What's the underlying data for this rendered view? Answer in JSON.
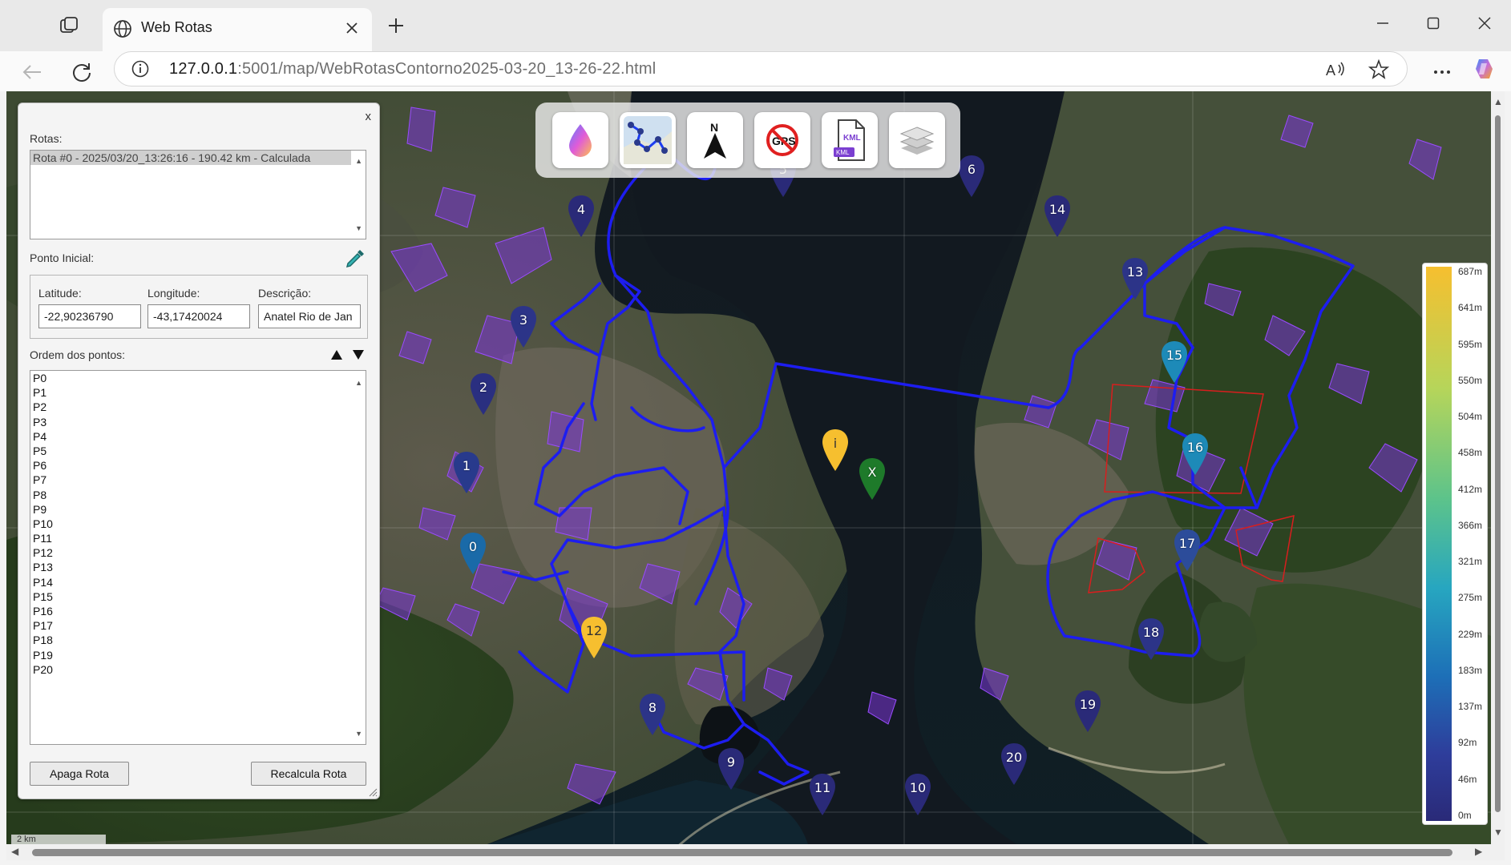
{
  "browser": {
    "tab_title": "Web Rotas",
    "url_host": "127.0.0.1",
    "url_rest": ":5001/map/WebRotasContorno2025-03-20_13-26-22.html"
  },
  "panel": {
    "close_label": "x",
    "routes_label": "Rotas:",
    "routes": [
      "Rota #0 - 2025/03/20_13:26:16 - 190.42 km - Calculada"
    ],
    "start_label": "Ponto Inicial:",
    "lat_label": "Latitude:",
    "lon_label": "Longitude:",
    "desc_label": "Descrição:",
    "lat_value": "-22,90236790",
    "lon_value": "-43,17420024",
    "desc_value": "Anatel Rio de Jan",
    "order_label": "Ordem dos pontos:",
    "points": [
      "P0",
      "P1",
      "P2",
      "P3",
      "P4",
      "P5",
      "P6",
      "P7",
      "P8",
      "P9",
      "P10",
      "P11",
      "P12",
      "P13",
      "P14",
      "P15",
      "P16",
      "P17",
      "P18",
      "P19",
      "P20"
    ],
    "delete_button": "Apaga Rota",
    "recalc_button": "Recalcula Rota"
  },
  "toolbar_icons": [
    "elevation-drop-icon",
    "route-map-icon",
    "north-arrow-icon",
    "no-gps-icon",
    "kml-file-icon",
    "layers-icon"
  ],
  "legend": {
    "labels": [
      "687m",
      "641m",
      "595m",
      "550m",
      "504m",
      "458m",
      "412m",
      "366m",
      "321m",
      "275m",
      "229m",
      "183m",
      "137m",
      "92m",
      "46m",
      "0m"
    ],
    "colors": {
      "top": "#f6bf2f",
      "middle": "#27a6c0",
      "bottom": "#2a2a78"
    }
  },
  "markers": {
    "start": "i",
    "end": "X",
    "points": [
      "0",
      "1",
      "2",
      "3",
      "4",
      "5",
      "6",
      "8",
      "9",
      "10",
      "11",
      "12",
      "13",
      "14",
      "15",
      "16",
      "17",
      "18",
      "19",
      "20"
    ]
  },
  "scale_label": "2 km"
}
